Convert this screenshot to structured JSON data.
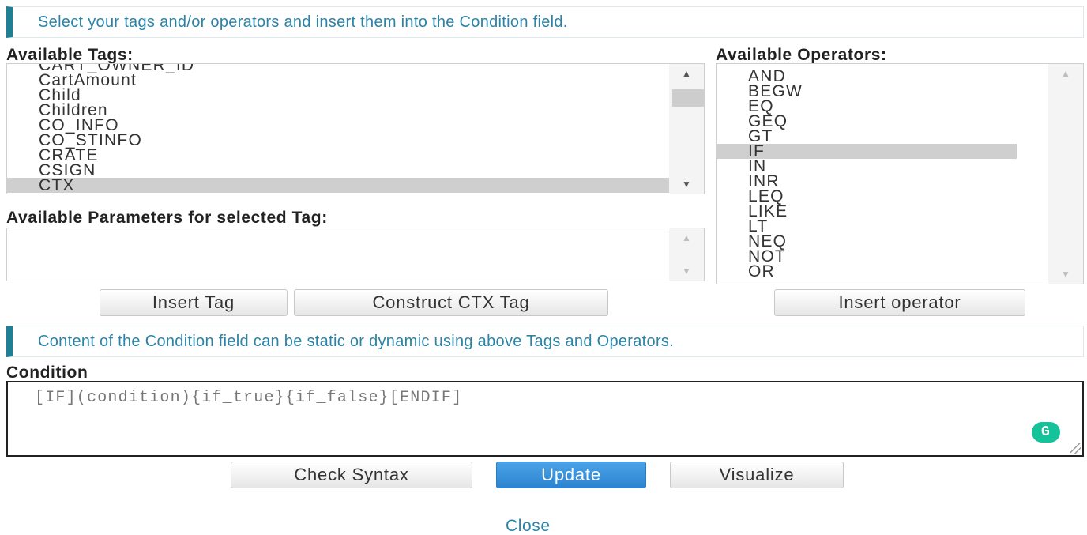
{
  "info_top": "Select your tags and/or operators and insert them into the Condition field.",
  "tags": {
    "label": "Available Tags:",
    "items": [
      "CART_OWNER_ID",
      "CartAmount",
      "Child",
      "Children",
      "CO_INFO",
      "CO_STINFO",
      "CRATE",
      "CSIGN",
      "CTX"
    ],
    "selected": "CTX"
  },
  "operators": {
    "label": "Available Operators:",
    "items": [
      "AND",
      "BEGW",
      "EQ",
      "GEQ",
      "GT",
      "IF",
      "IN",
      "INR",
      "LEQ",
      "LIKE",
      "LT",
      "NEQ",
      "NOT",
      "OR"
    ],
    "selected": "IF"
  },
  "parameters": {
    "label": "Available Parameters for selected Tag:"
  },
  "buttons": {
    "insert_tag": "Insert Tag",
    "construct_ctx": "Construct CTX Tag",
    "insert_operator": "Insert operator",
    "check_syntax": "Check Syntax",
    "update": "Update",
    "visualize": "Visualize"
  },
  "info_condition": "Content of the Condition field can be static or dynamic using above Tags and Operators.",
  "condition": {
    "label": "Condition",
    "value": "[IF](condition){if_true}{if_false}[ENDIF]"
  },
  "grammarly_icon": "G",
  "close_link": "Close",
  "colors": {
    "accent": "#1f7f93",
    "link": "#2a84a8",
    "primary_button": "#2c84d0",
    "selected_row": "#cfcfcf",
    "grammarly": "#15c39a"
  }
}
